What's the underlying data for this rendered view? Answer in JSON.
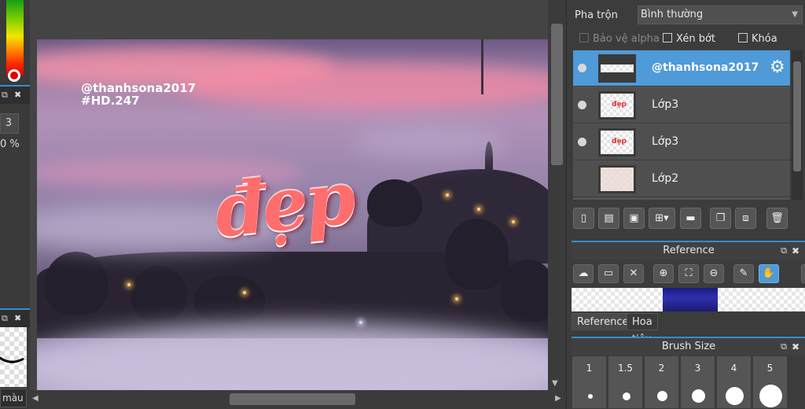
{
  "left_panel": {
    "num_value": "3",
    "pct_value": "0 %",
    "color_tab_label": "màu"
  },
  "canvas": {
    "watermark_line1": "@thanhsona2017",
    "watermark_line2": "#HD.247",
    "art_text": "đẹp"
  },
  "right_panel": {
    "blend_label": "Pha trộn",
    "blend_mode": "Bình thường",
    "protect_alpha_label": "Bảo vệ alpha",
    "clip_label": "Xén bớt",
    "lock_label": "Khóa",
    "layers": [
      {
        "name": "@thanhsona2017",
        "selected": true,
        "visible": true,
        "thumb_mark": ""
      },
      {
        "name": "Lớp3",
        "selected": false,
        "visible": true,
        "thumb_mark": "đẹp"
      },
      {
        "name": "Lớp3",
        "selected": false,
        "visible": true,
        "thumb_mark": "đẹp"
      },
      {
        "name": "Lớp2",
        "selected": false,
        "visible": false,
        "thumb_mark": ""
      }
    ],
    "reference": {
      "title": "Reference",
      "tabs": [
        "Reference",
        "Hoa tiêu"
      ]
    },
    "brush_size": {
      "title": "Brush Size",
      "sizes": [
        "1",
        "1.5",
        "2",
        "3",
        "4",
        "5"
      ]
    }
  },
  "colors": {
    "accent": "#4f9ad8",
    "panel_header_border": "#2d8fd5"
  }
}
